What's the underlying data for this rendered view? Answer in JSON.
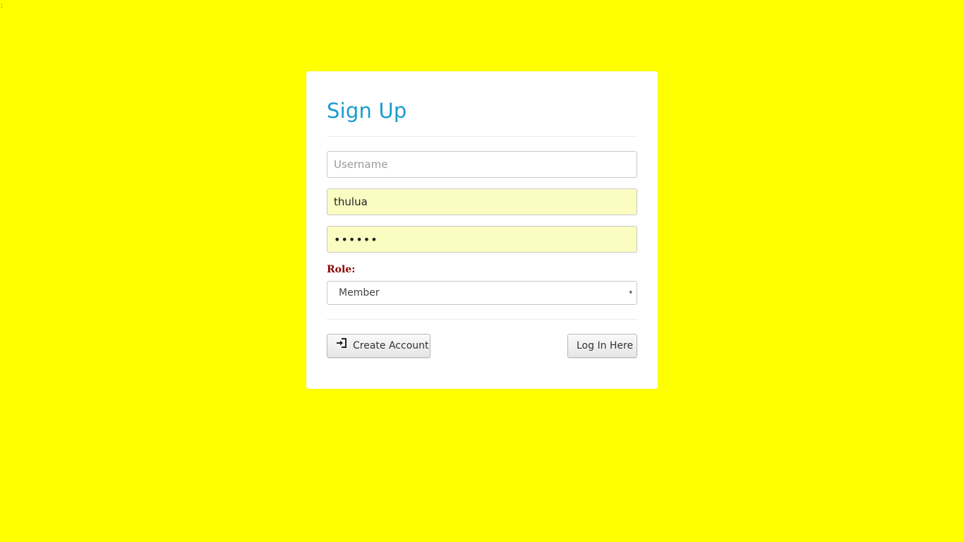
{
  "corner_mark": ";",
  "form": {
    "title": "Sign Up",
    "username": {
      "placeholder": "Username",
      "value": ""
    },
    "email": {
      "value": "thulua"
    },
    "password": {
      "value": "••••••"
    },
    "role": {
      "label": "Role:",
      "selected": "Member",
      "caret": "▾"
    },
    "buttons": {
      "create_account": "Create Account",
      "login": "Log In Here"
    }
  },
  "colors": {
    "background": "#ffff00",
    "title": "#1a9cd0",
    "role_label": "#8b0000",
    "autofill": "#fafcc2"
  },
  "icons": {
    "create_account": "sign-in-icon"
  }
}
